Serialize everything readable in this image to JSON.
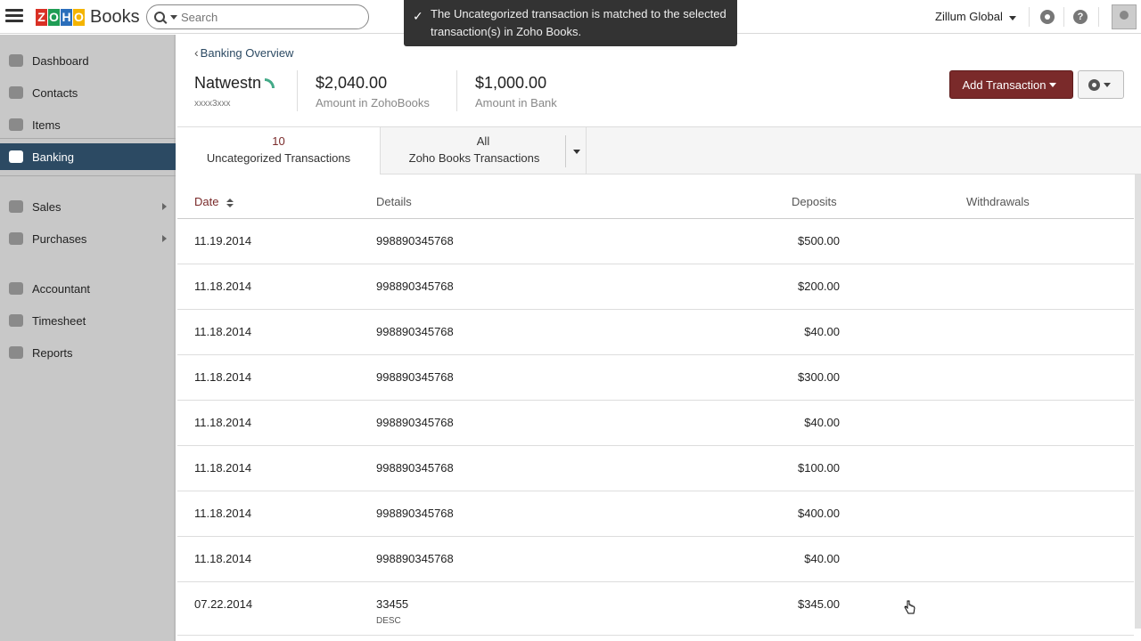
{
  "topbar": {
    "logo_letters": [
      "Z",
      "O",
      "H",
      "O"
    ],
    "logo_colors": [
      "#d93025",
      "#1f9d55",
      "#2a6ebb",
      "#f4b400"
    ],
    "logo_text": "Books",
    "search_placeholder": "Search",
    "org_name": "Zillum Global"
  },
  "toast": {
    "message": "The Uncategorized transaction is matched to the selected transaction(s) in Zoho Books."
  },
  "sidebar": {
    "items": [
      {
        "label": "Dashboard"
      },
      {
        "label": "Contacts"
      },
      {
        "label": "Items"
      },
      {
        "label": "Banking"
      },
      {
        "label": "Sales"
      },
      {
        "label": "Purchases"
      },
      {
        "label": "Accountant"
      },
      {
        "label": "Timesheet"
      },
      {
        "label": "Reports"
      }
    ]
  },
  "header": {
    "back_label": "Banking Overview",
    "account_name": "Natwestn",
    "account_mask": "xxxx3xxx",
    "amount_books": "$2,040.00",
    "amount_books_label": "Amount in ZohoBooks",
    "amount_bank": "$1,000.00",
    "amount_bank_label": "Amount in Bank",
    "add_button": "Add Transaction"
  },
  "tabs": {
    "uncategorized_count": "10",
    "uncategorized_label": "Uncategorized Transactions",
    "all_label": "All",
    "books_label": "Zoho Books Transactions"
  },
  "table": {
    "columns": {
      "date": "Date",
      "details": "Details",
      "deposits": "Deposits",
      "withdrawals": "Withdrawals"
    },
    "rows": [
      {
        "date": "11.19.2014",
        "details": "998890345768",
        "deposit": "$500.00",
        "withdrawal": "",
        "desc": ""
      },
      {
        "date": "11.18.2014",
        "details": "998890345768",
        "deposit": "$200.00",
        "withdrawal": "",
        "desc": ""
      },
      {
        "date": "11.18.2014",
        "details": "998890345768",
        "deposit": "$40.00",
        "withdrawal": "",
        "desc": ""
      },
      {
        "date": "11.18.2014",
        "details": "998890345768",
        "deposit": "$300.00",
        "withdrawal": "",
        "desc": ""
      },
      {
        "date": "11.18.2014",
        "details": "998890345768",
        "deposit": "$40.00",
        "withdrawal": "",
        "desc": ""
      },
      {
        "date": "11.18.2014",
        "details": "998890345768",
        "deposit": "$100.00",
        "withdrawal": "",
        "desc": ""
      },
      {
        "date": "11.18.2014",
        "details": "998890345768",
        "deposit": "$400.00",
        "withdrawal": "",
        "desc": ""
      },
      {
        "date": "11.18.2014",
        "details": "998890345768",
        "deposit": "$40.00",
        "withdrawal": "",
        "desc": ""
      },
      {
        "date": "07.22.2014",
        "details": "33455",
        "deposit": "$345.00",
        "withdrawal": "",
        "desc": "DESC"
      }
    ]
  },
  "colors": {
    "brand_dark": "#2c4a63",
    "accent_red": "#7a2a2a"
  }
}
